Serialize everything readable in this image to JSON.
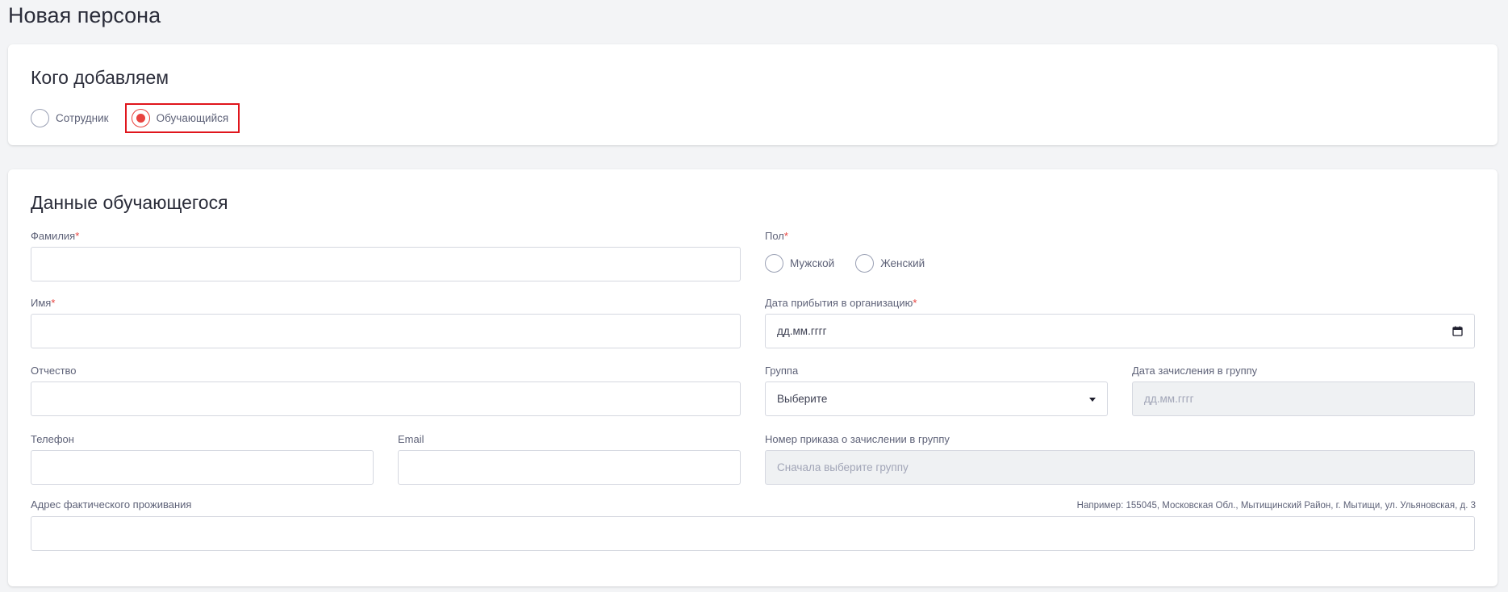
{
  "page": {
    "title": "Новая персона"
  },
  "who": {
    "title": "Кого добавляем",
    "options": [
      {
        "label": "Сотрудник",
        "checked": false
      },
      {
        "label": "Обучающийся",
        "checked": true
      }
    ]
  },
  "student": {
    "title": "Данные обучающегося",
    "required_mark": "*",
    "fields": {
      "last_name": {
        "label": "Фамилия",
        "required": true,
        "value": ""
      },
      "first_name": {
        "label": "Имя",
        "required": true,
        "value": ""
      },
      "patronymic": {
        "label": "Отчество",
        "required": false,
        "value": ""
      },
      "phone": {
        "label": "Телефон",
        "required": false,
        "value": ""
      },
      "email": {
        "label": "Email",
        "required": false,
        "value": ""
      },
      "address": {
        "label": "Адрес фактического проживания",
        "hint": "Например: 155045, Московская Обл., Мытищинский Район, г. Мытищи, ул. Ульяновская, д. 3",
        "value": ""
      },
      "gender": {
        "label": "Пол",
        "required": true,
        "options": [
          {
            "label": "Мужской",
            "checked": false
          },
          {
            "label": "Женский",
            "checked": false
          }
        ]
      },
      "arrival_date": {
        "label": "Дата прибытия в организацию",
        "required": true,
        "placeholder": "дд.мм.гггг"
      },
      "group": {
        "label": "Группа",
        "selected": "Выберите"
      },
      "enroll_date": {
        "label": "Дата зачисления в группу",
        "placeholder": "дд.мм.гггг",
        "disabled": true
      },
      "order_number": {
        "label": "Номер приказа о зачислении в группу",
        "placeholder": "Сначала выберите группу",
        "disabled": true
      }
    }
  },
  "colors": {
    "accent": "#e8433f",
    "highlight_border": "#e0151c",
    "page_bg": "#f3f4f6",
    "disabled_bg": "#eff1f3"
  },
  "icons": {
    "calendar": "calendar-icon",
    "dropdown": "chevron-down-icon"
  }
}
